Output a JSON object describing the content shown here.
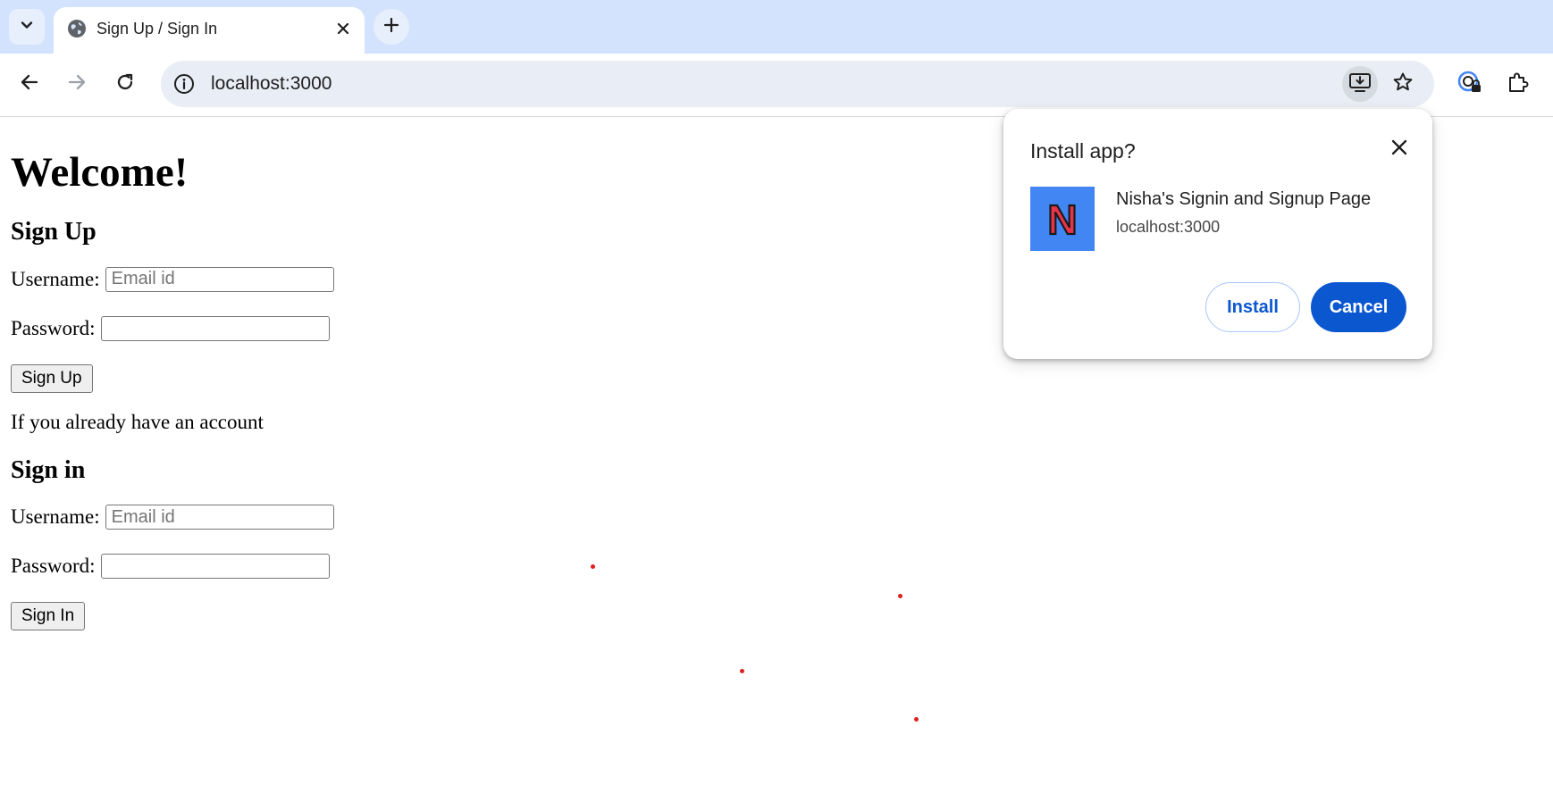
{
  "browser": {
    "tab": {
      "title": "Sign Up / Sign In"
    },
    "address_bar": {
      "url": "localhost:3000"
    }
  },
  "page": {
    "heading": "Welcome!",
    "signup": {
      "title": "Sign Up",
      "username_label": "Username:",
      "username_placeholder": "Email id",
      "username_value": "",
      "password_label": "Password:",
      "password_value": "",
      "button_label": "Sign Up"
    },
    "account_text": "If you already have an account",
    "signin": {
      "title": "Sign in",
      "username_label": "Username:",
      "username_placeholder": "Email id",
      "username_value": "",
      "password_label": "Password:",
      "password_value": "",
      "button_label": "Sign In"
    }
  },
  "install_popup": {
    "title": "Install app?",
    "app_icon_letter": "N",
    "app_name": "Nisha's Signin and Signup Page",
    "app_origin": "localhost:3000",
    "install_label": "Install",
    "cancel_label": "Cancel"
  },
  "icons": [
    "chevron-down-icon",
    "globe-icon",
    "close-icon",
    "plus-icon",
    "back-arrow-icon",
    "forward-arrow-icon",
    "reload-icon",
    "info-icon",
    "install-app-icon",
    "star-icon",
    "password-manager-icon",
    "extensions-icon"
  ],
  "colors": {
    "tabstrip": "#d3e3fd",
    "omnibox": "#e9eef6",
    "accent": "#0b57d0",
    "app_icon_bg": "#4286f4",
    "app_icon_letter": "#e8344a",
    "dots": "#e02020"
  }
}
